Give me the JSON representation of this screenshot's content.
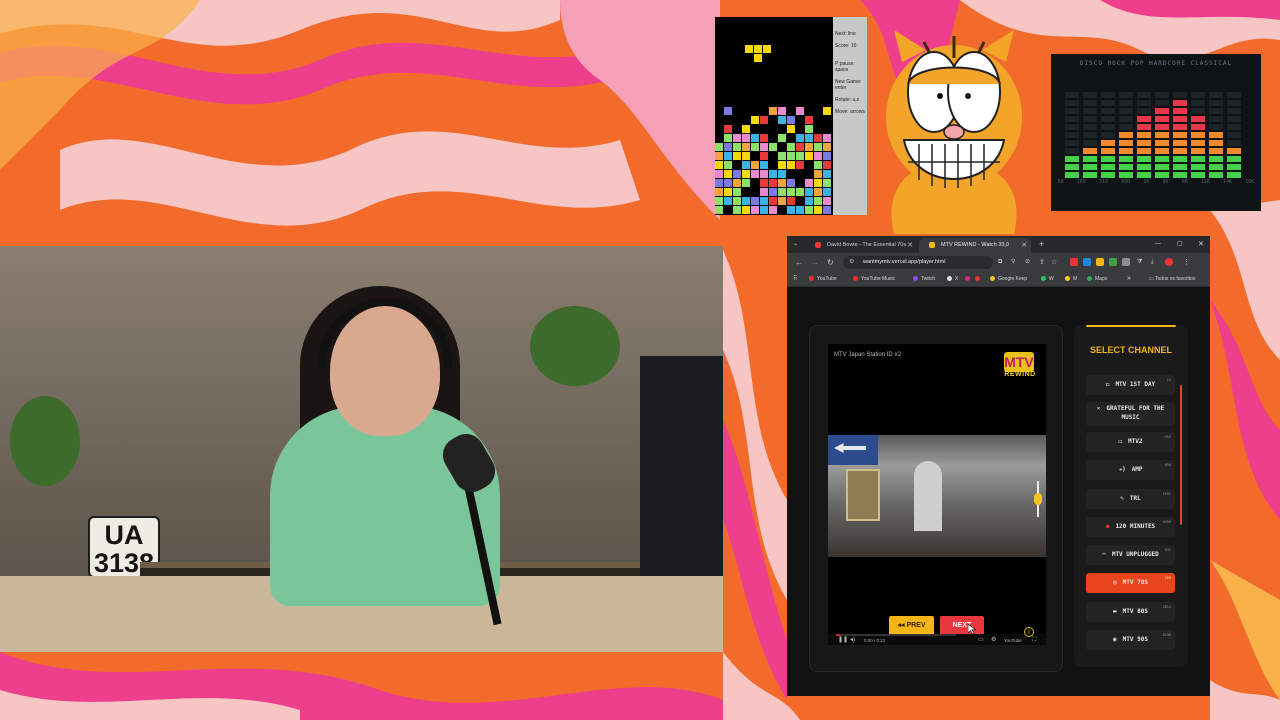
{
  "overlay": {
    "plate_lines": [
      "UA",
      "3138"
    ],
    "tetris": {
      "side_lines": [
        "Next: line",
        "Score: 10",
        "P:pause: space",
        "New Game: enter",
        "Rotate: u,s",
        "Move: arrows"
      ]
    },
    "equalizer": {
      "title": "DISCO ROCK  POP  HARDCORE  CLASSICAL",
      "labels": [
        "60",
        "160",
        "310",
        "600",
        "1K",
        "3K",
        "6K",
        "12K",
        "14K",
        "16K"
      ]
    }
  },
  "browser": {
    "tabs": [
      {
        "title": "David Bowie - The Essential 70s",
        "active": false
      },
      {
        "title": "MTV REWIND - Watch 33,0",
        "active": true
      }
    ],
    "new_tab_label": "+",
    "window_controls": [
      "—",
      "▢",
      "✕"
    ],
    "url": "wantmymtv.vercel.app/player.html",
    "bookmarks": [
      {
        "label": "YouTube",
        "color": "#ff2a2a"
      },
      {
        "label": "YouTube Music",
        "color": "#ff2a2a"
      },
      {
        "label": "Twitch",
        "color": "#9146ff"
      },
      {
        "label": "X",
        "color": "#dddddd"
      },
      {
        "label": "Google Keep",
        "color": "#f6c02c"
      },
      {
        "label": "W",
        "color": "#22c55e"
      },
      {
        "label": "M",
        "color": "#facc15"
      },
      {
        "label": "Maps",
        "color": "#34a853"
      }
    ],
    "bookmarks_more": "»",
    "bookmarks_folder": "Todos os favoritos"
  },
  "player": {
    "video_title": "MTV Japan Station ID #2",
    "logo_text": "MTV",
    "logo_subtext": "REWIND",
    "prev_label": "◂◂ PREV",
    "next_label": "NEXT",
    "timecode": "0:00 / 0:22",
    "youtube_label": "YouTube",
    "info_label": "i"
  },
  "channel_panel": {
    "title": "SELECT CHANNEL",
    "channels": [
      {
        "label": "MTV 1ST DAY",
        "icon": "◻",
        "count": "11",
        "active": false
      },
      {
        "label": "GRATEFUL FOR THE MUSIC",
        "icon": "✕",
        "count": "",
        "active": false
      },
      {
        "label": "MTV2",
        "icon": "◻",
        "count": "453",
        "active": false
      },
      {
        "label": "AMP",
        "icon": "◂)",
        "count": "694",
        "active": false
      },
      {
        "label": "TRL",
        "icon": "✎",
        "count": "1697",
        "active": false
      },
      {
        "label": "120 MINUTES",
        "icon": "●",
        "count": "4956",
        "active": false
      },
      {
        "label": "MTV UNPLUGGED",
        "icon": "⌒",
        "count": "537",
        "active": false
      },
      {
        "label": "MTV 70S",
        "icon": "◎",
        "count": "269",
        "active": true
      },
      {
        "label": "MTV 80S",
        "icon": "▬",
        "count": "2811",
        "active": false
      },
      {
        "label": "MTV 90S",
        "icon": "◉",
        "count": "5230",
        "active": false
      }
    ]
  },
  "colors": {
    "accent_orange": "#e8451d",
    "accent_yellow": "#f5b517",
    "next_red": "#e8373f"
  }
}
